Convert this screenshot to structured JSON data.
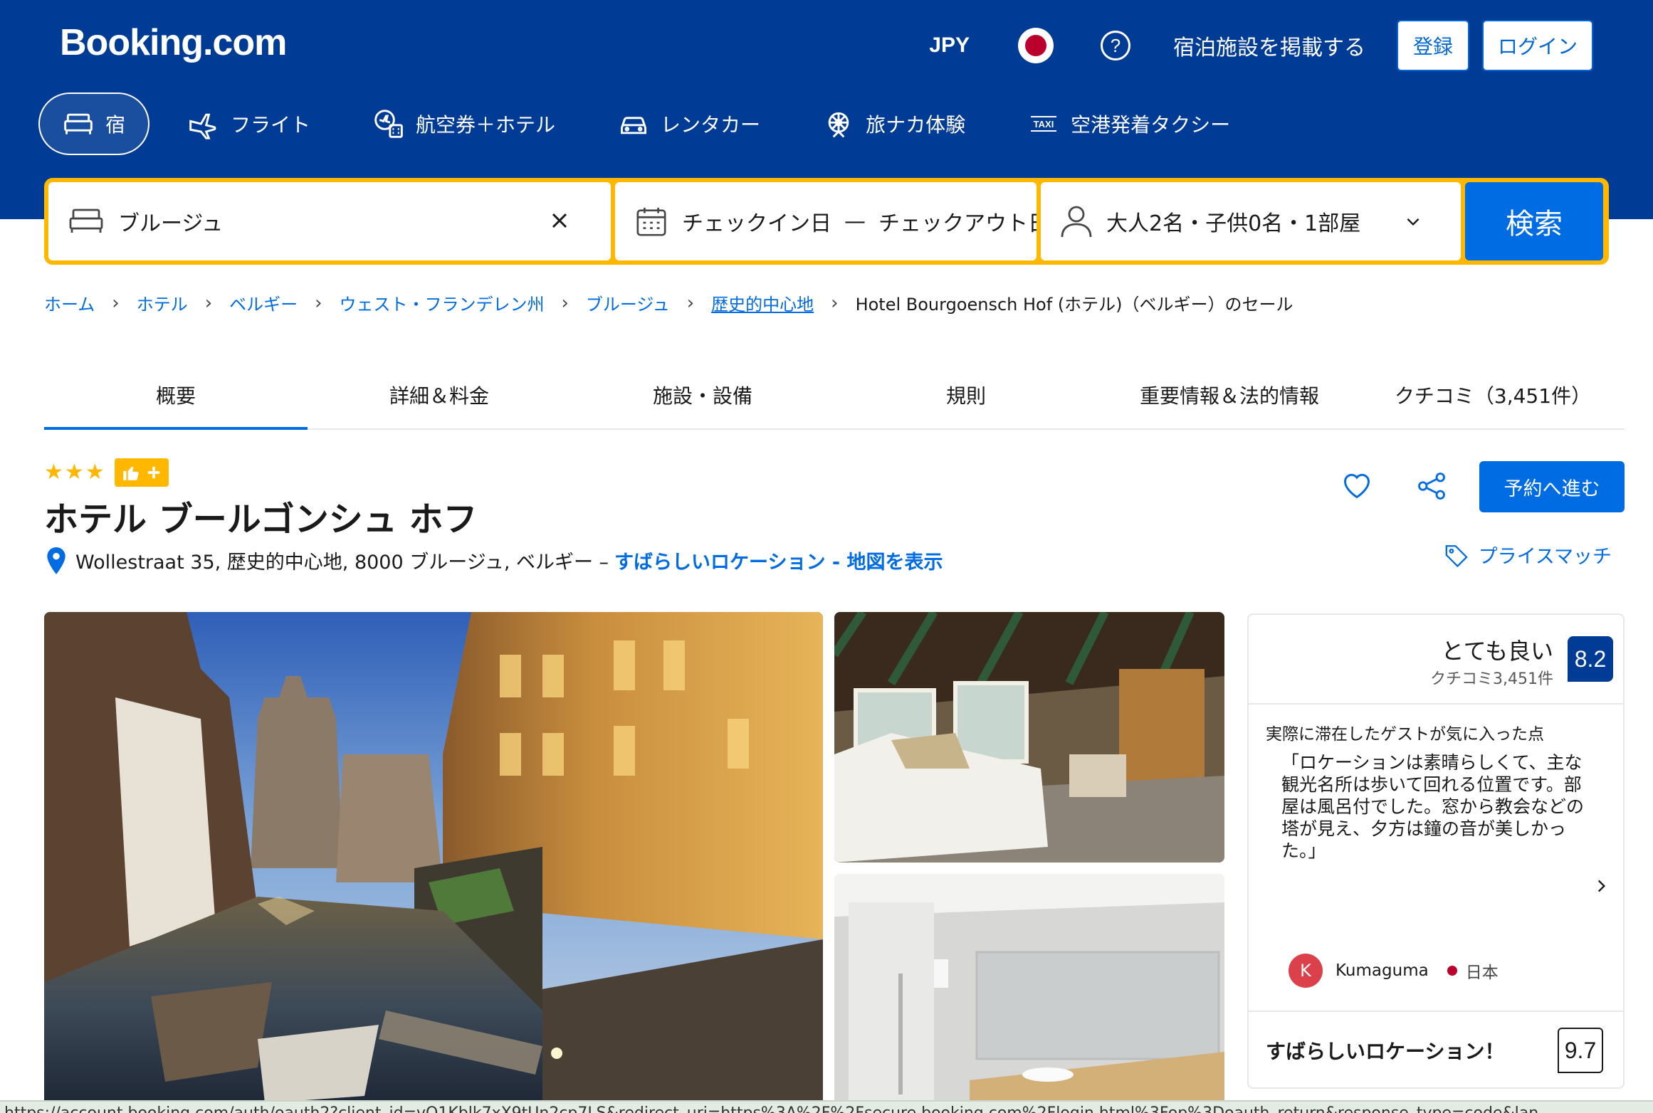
{
  "brand": {
    "logo": "Booking.com"
  },
  "header": {
    "currency": "JPY",
    "list_property": "宿泊施設を掲載する",
    "register_label": "登録",
    "login_label": "ログイン"
  },
  "nav": {
    "items": [
      {
        "label": "宿",
        "icon": "bed-icon"
      },
      {
        "label": "フライト",
        "icon": "plane-icon"
      },
      {
        "label": "航空券＋ホテル",
        "icon": "plane-hotel-icon"
      },
      {
        "label": "レンタカー",
        "icon": "car-icon"
      },
      {
        "label": "旅ナカ体験",
        "icon": "attractions-icon"
      },
      {
        "label": "空港発着タクシー",
        "icon": "taxi-icon"
      }
    ]
  },
  "search": {
    "destination": "ブルージュ",
    "checkin": "チェックイン日",
    "date_separator": "—",
    "checkout": "チェックアウト日",
    "guests": "大人2名・子供0名・1部屋",
    "button_label": "検索"
  },
  "breadcrumb": {
    "items": [
      "ホーム",
      "ホテル",
      "ベルギー",
      "ウェスト・フランデレン州",
      "ブルージュ",
      "歴史的中心地"
    ],
    "current": "Hotel Bourgoensch Hof (ホテル)（ベルギー）のセール"
  },
  "tabs": [
    "概要",
    "詳細＆料金",
    "施設・設備",
    "規則",
    "重要情報＆法的情報",
    "クチコミ（3,451件）"
  ],
  "hotel": {
    "stars": 3,
    "name": "ホテル ブールゴンシュ ホフ",
    "address": "Wollestraat 35, 歴史的中心地, 8000 ブルージュ, ベルギー –",
    "location_link": "すばらしいロケーション - 地図を表示",
    "reserve_label": "予約へ進む",
    "price_match_label": "プライスマッチ"
  },
  "review": {
    "label": "とても良い",
    "count": "クチコミ3,451件",
    "score": "8.2",
    "liked_heading": "実際に滞在したゲストが気に入った点",
    "quote": "「ロケーションは素晴らしくて、主な観光名所は歩いて回れる位置です。部屋は風呂付でした。窓から教会などの塔が見え、夕方は鐘の音が美しかった。」",
    "reviewer_initial": "K",
    "reviewer_name": "Kumaguma",
    "reviewer_country": "日本",
    "location_label": "すばらしいロケーション！",
    "location_score": "9.7"
  },
  "status_url": "https://account.booking.com/auth/oauth2?client_id=vO1Kblk7xX9tUn2cp7LS&redirect_uri=https%3A%2F%2Fsecure.booking.com%2Flogin.html%3Fop%3Doauth_return&response_type=code&lan",
  "colors": {
    "brand_blue": "#003b95",
    "accent_blue": "#006ce4",
    "yellow": "#ffb700"
  }
}
